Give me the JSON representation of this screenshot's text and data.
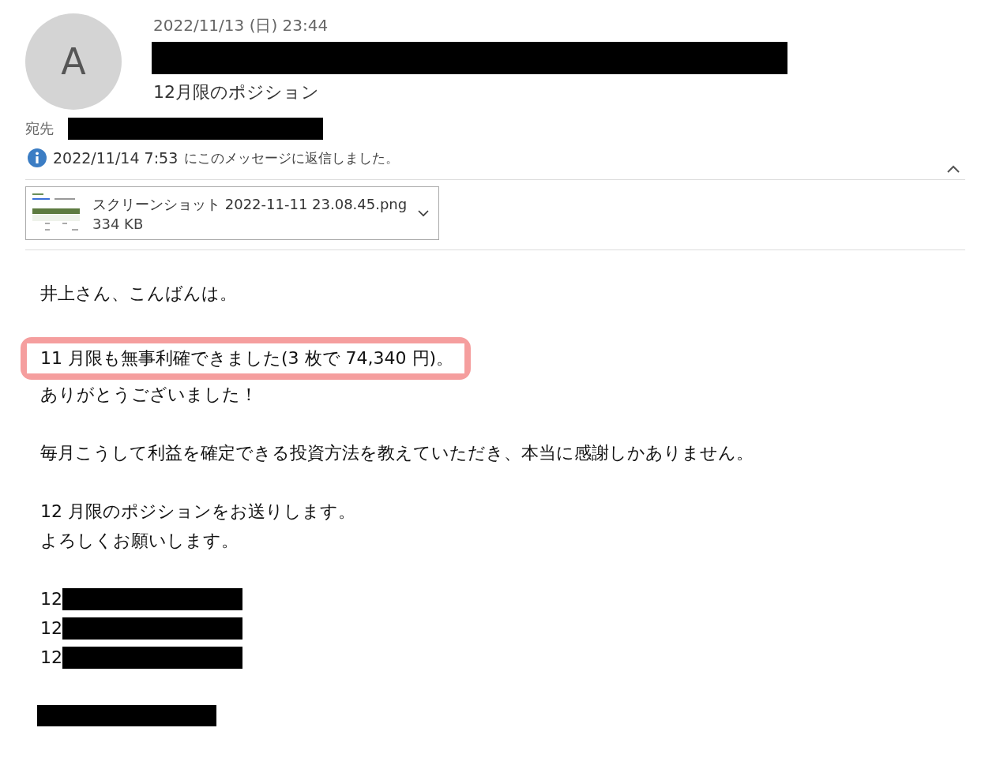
{
  "header": {
    "avatar_initial": "A",
    "date": "2022/11/13 (日) 23:44",
    "sender": {
      "redacted": true
    },
    "subject": "12月限のポジション",
    "to_label": "宛先",
    "to": {
      "redacted": true
    },
    "info": {
      "time": "2022/11/14 7:53",
      "text": "にこのメッセージに返信しました。"
    },
    "expanded": true
  },
  "attachment": {
    "name": "スクリーンショット 2022-11-11 23.08.45.png",
    "size": "334 KB"
  },
  "body": [
    {
      "kind": "text",
      "text": "井上さん、こんばんは。"
    },
    {
      "kind": "blank"
    },
    {
      "kind": "highlight",
      "text": "11 月限も無事利確できました(3 枚で 74,340 円)。"
    },
    {
      "kind": "text",
      "text": "ありがとうございました！"
    },
    {
      "kind": "blank"
    },
    {
      "kind": "text",
      "text": "毎月こうして利益を確定できる投資方法を教えていただき、本当に感謝しかありません。"
    },
    {
      "kind": "blank"
    },
    {
      "kind": "text",
      "text": "12 月限のポジションをお送りします。"
    },
    {
      "kind": "text",
      "text": "よろしくお願いします。"
    },
    {
      "kind": "blank"
    },
    {
      "kind": "redacted",
      "text": "12"
    },
    {
      "kind": "redacted",
      "text": "12"
    },
    {
      "kind": "redacted",
      "text": "12"
    },
    {
      "kind": "blank"
    },
    {
      "kind": "redacted"
    }
  ]
}
